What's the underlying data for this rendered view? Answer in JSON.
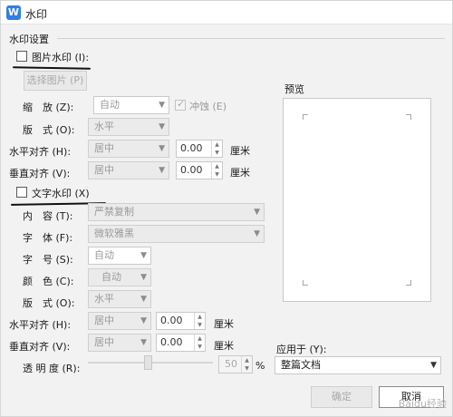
{
  "window": {
    "title": "水印",
    "app_icon": "W",
    "app_icon_color": "#2f7fe6"
  },
  "group_label": "水印设置",
  "picture_watermark": {
    "checkbox_label": "图片水印 (I):",
    "checked": false,
    "select_picture_button": "选择图片 (P)",
    "scale_label": "缩　放 (Z):",
    "scale_value": "自动",
    "washout_label": "冲蚀 (E)",
    "layout_label": "版　式 (O):",
    "layout_value": "水平",
    "halign_label": "水平对齐 (H):",
    "halign_value": "居中",
    "halign_offset": "0.00",
    "valign_label": "垂直对齐 (V):",
    "valign_value": "居中",
    "valign_offset": "0.00",
    "unit": "厘米"
  },
  "text_watermark": {
    "checkbox_label": "文字水印 (X)",
    "checked": false,
    "content_label": "内　容 (T):",
    "content_value": "严禁复制",
    "font_label": "字　体 (F):",
    "font_value": "微软雅黑",
    "size_label": "字　号 (S):",
    "size_value": "自动",
    "color_label": "颜　色 (C):",
    "color_value": "自动",
    "layout_label": "版　式 (O):",
    "layout_value": "水平",
    "halign_label": "水平对齐 (H):",
    "halign_value": "居中",
    "halign_offset": "0.00",
    "valign_label": "垂直对齐 (V):",
    "valign_value": "居中",
    "valign_offset": "0.00",
    "unit": "厘米",
    "transparency_label": "透 明 度 (R):",
    "transparency_value": "50",
    "transparency_unit": "%"
  },
  "preview": {
    "label": "预览"
  },
  "apply_to": {
    "label": "应用于 (Y):",
    "value": "整篇文档"
  },
  "buttons": {
    "ok": "确定",
    "cancel": "取消"
  },
  "watermark_text": "Baidu经验"
}
